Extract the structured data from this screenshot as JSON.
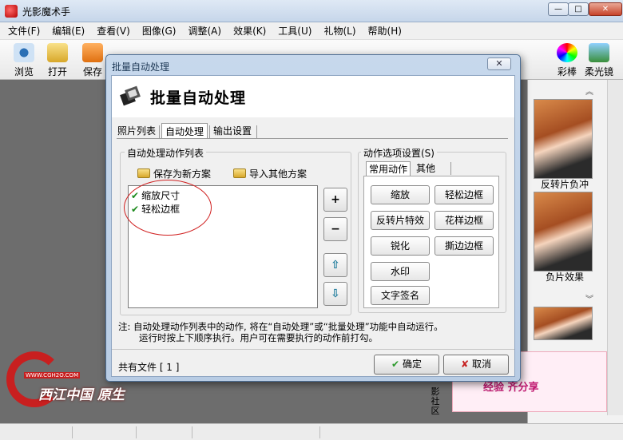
{
  "app": {
    "title": "光影魔术手"
  },
  "menu": [
    "文件(F)",
    "编辑(E)",
    "查看(V)",
    "图像(G)",
    "调整(A)",
    "效果(K)",
    "工具(U)",
    "礼物(L)",
    "帮助(H)"
  ],
  "toolbar": {
    "browse": "浏览",
    "open": "打开",
    "save": "保存",
    "colorful": "彩棒",
    "softglow": "柔光镜"
  },
  "side": {
    "thumb1_caption": "反转片负冲",
    "thumb2_caption": "负片效果"
  },
  "ad": {
    "text": "经验 齐分享",
    "community": "影社区"
  },
  "dialog": {
    "title": "批量自动处理",
    "heading": "批量自动处理",
    "close_label": "✕",
    "tabs": [
      "照片列表",
      "自动处理",
      "输出设置"
    ],
    "left_group": {
      "title": "自动处理动作列表",
      "save_scheme": "保存为新方案",
      "import_scheme": "导入其他方案",
      "actions": [
        "缩放尺寸",
        "轻松边框"
      ]
    },
    "right_group": {
      "title": "动作选项设置(S)",
      "tabs": [
        "常用动作",
        "其他"
      ],
      "buttons": {
        "scale": "缩放",
        "easy_border": "轻松边框",
        "reversal": "反转片特效",
        "fancy_border": "花样边框",
        "sharpen": "锐化",
        "torn_border": "撕边边框",
        "watermark": "水印",
        "text_signature": "文字签名"
      }
    },
    "note_line1": "注: 自动处理动作列表中的动作, 将在“自动处理”或“批量处理”功能中自动运行。",
    "note_line2": "运行时按上下顺序执行。用户可在需要执行的动作前打勾。",
    "file_count": "共有文件 [ 1 ]",
    "ok": "确定",
    "cancel": "取消"
  },
  "watermark": {
    "text": "西江中国 原生",
    "url": "WWW.CGH2O.COM"
  },
  "colors": {
    "accent": "#4c6d93",
    "check": "#1c8a1c",
    "annotation": "#d02020"
  }
}
